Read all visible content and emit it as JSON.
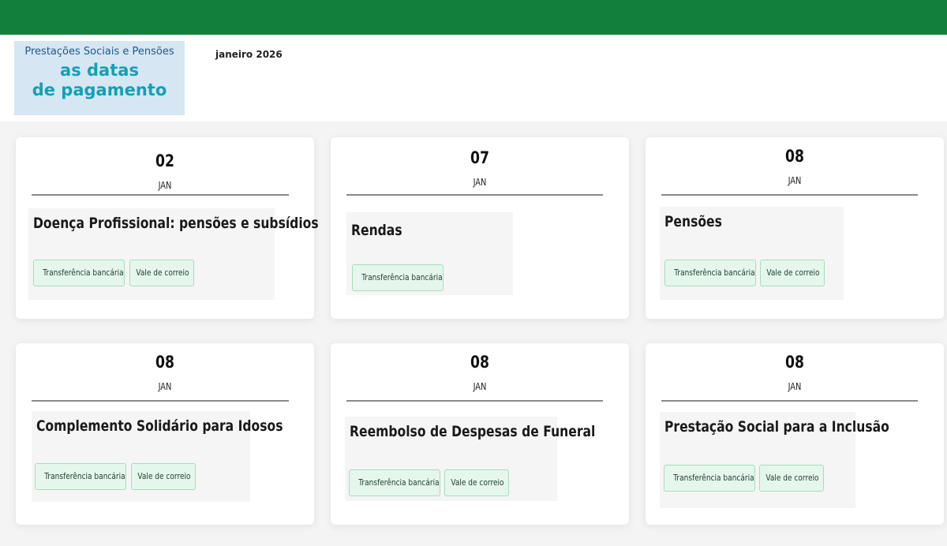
{
  "header": {
    "logo_line1": "Prestações Sociais e Pensões",
    "logo_line2a": "as datas",
    "logo_line2b": "de pagamento",
    "month": "janeiro 2026"
  },
  "colors": {
    "brand": "#12803d",
    "tag_bg": "#e5f7ec",
    "logo_bg": "#d6e6f3",
    "logo_accent": "#12a0b8"
  },
  "cards": [
    {
      "day": "02",
      "month": "JAN",
      "title": "Doença Profissional: pensões e subsídios",
      "tags": [
        "Transferência bancária",
        "Vale de correio"
      ]
    },
    {
      "day": "07",
      "month": "JAN",
      "title": "Rendas",
      "tags": [
        "Transferência bancária"
      ]
    },
    {
      "day": "08",
      "month": "JAN",
      "title": "Pensões",
      "tags": [
        "Transferência bancária",
        "Vale de correio"
      ]
    },
    {
      "day": "08",
      "month": "JAN",
      "title": "Complemento Solidário para Idosos",
      "tags": [
        "Transferência bancária",
        "Vale de correio"
      ]
    },
    {
      "day": "08",
      "month": "JAN",
      "title": "Reembolso de Despesas de Funeral",
      "tags": [
        "Transferência bancária",
        "Vale de correio"
      ]
    },
    {
      "day": "08",
      "month": "JAN",
      "title": "Prestação Social para a Inclusão",
      "tags": [
        "Transferência bancária",
        "Vale de correio"
      ]
    }
  ]
}
